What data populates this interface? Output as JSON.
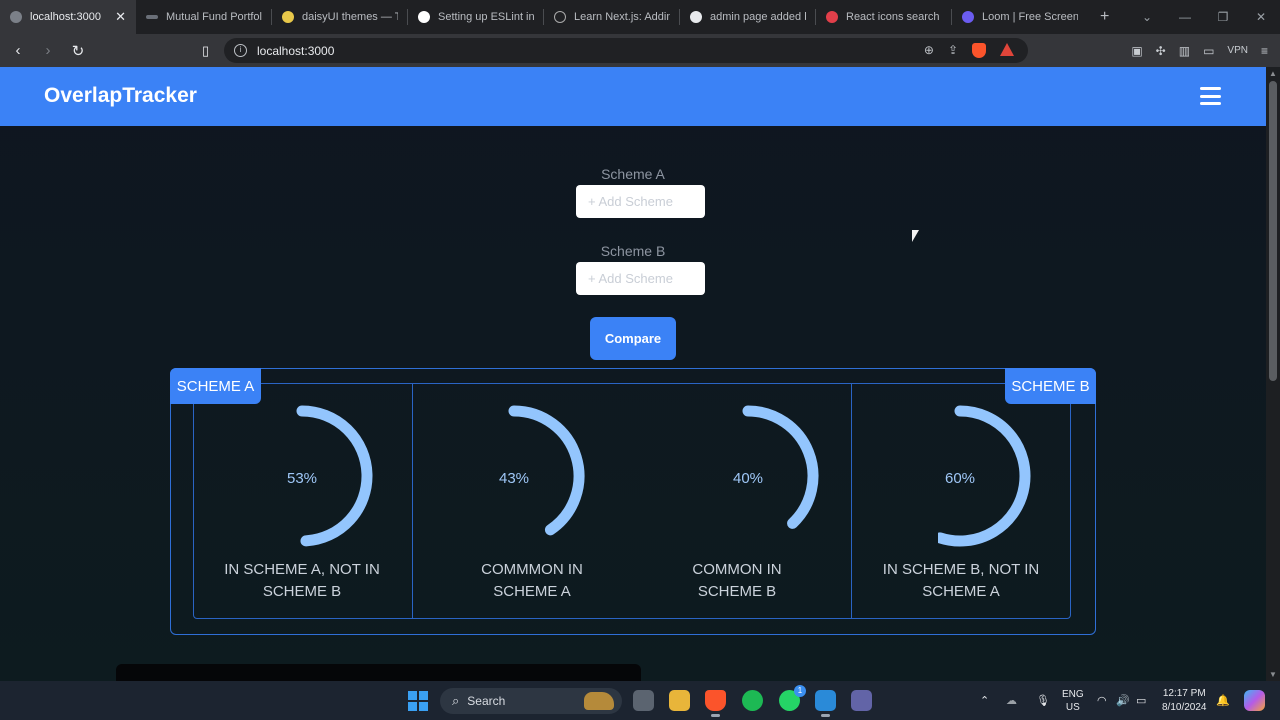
{
  "browser": {
    "tabs": [
      {
        "title": "localhost:3000",
        "active": true
      },
      {
        "title": "Mutual Fund Portfolio"
      },
      {
        "title": "daisyUI themes — Tailwind"
      },
      {
        "title": "Setting up ESLint in Next"
      },
      {
        "title": "Learn Next.js: Adding"
      },
      {
        "title": "admin page added by"
      },
      {
        "title": "React icons search re"
      },
      {
        "title": "Loom | Free Screen & Video"
      }
    ],
    "close_glyph": "✕",
    "new_tab_glyph": "+",
    "url": "localhost:3000",
    "vpn_label": "VPN"
  },
  "navbar": {
    "brand": "OverlapTracker"
  },
  "form": {
    "scheme_a_label": "Scheme A",
    "scheme_b_label": "Scheme B",
    "scheme_a_placeholder": "+ Add Scheme",
    "scheme_b_placeholder": "+ Add Scheme",
    "compare_label": "Compare"
  },
  "results": {
    "tag_a": "SCHEME A",
    "tag_b": "SCHEME B",
    "ring_color": "#93c5fd",
    "metrics": [
      {
        "percent": 53,
        "percent_label": "53%",
        "caption_line1": "IN SCHEME A, NOT IN",
        "caption_line2": "SCHEME B"
      },
      {
        "percent": 43,
        "percent_label": "43%",
        "caption_line1": "COMMMON IN",
        "caption_line2": "SCHEME A"
      },
      {
        "percent": 40,
        "percent_label": "40%",
        "caption_line1": "COMMON IN",
        "caption_line2": "SCHEME B"
      },
      {
        "percent": 60,
        "percent_label": "60%",
        "caption_line1": "IN SCHEME B, NOT IN",
        "caption_line2": "SCHEME A"
      }
    ]
  },
  "taskbar": {
    "search_label": "Search",
    "whatsapp_badge": "1",
    "language_line1": "ENG",
    "language_line2": "US",
    "time": "12:17 PM",
    "date": "8/10/2024"
  },
  "colors": {
    "accent": "#3b82f6",
    "page_bg": "#0f1720",
    "ring": "#93c5fd"
  }
}
